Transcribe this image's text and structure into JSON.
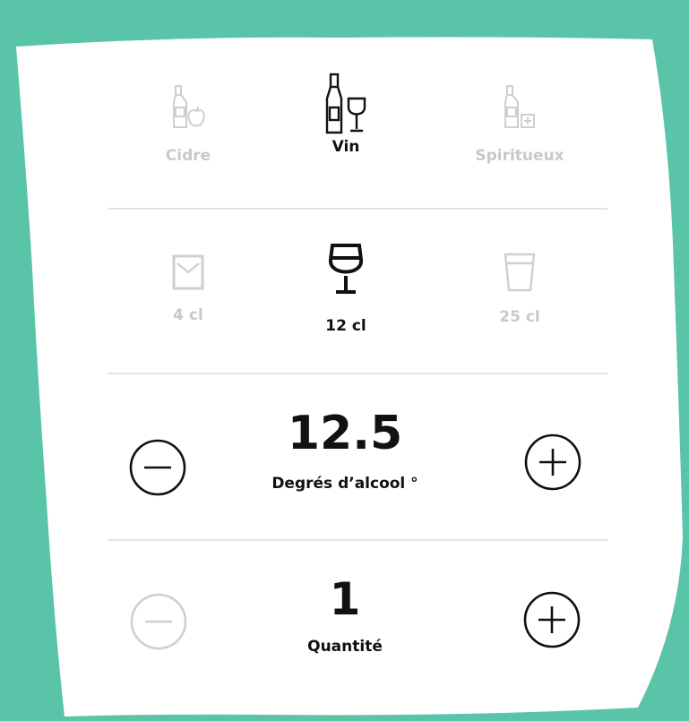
{
  "drink_types": [
    {
      "label": "Cidre",
      "icon": "cider-bottle-icon",
      "selected": false
    },
    {
      "label": "Vin",
      "icon": "wine-bottle-glass-icon",
      "selected": true
    },
    {
      "label": "Spiritueux",
      "icon": "spirits-bottle-icon",
      "selected": false
    }
  ],
  "volumes": [
    {
      "label": "4 cl",
      "icon": "shot-glass-icon",
      "selected": false
    },
    {
      "label": "12 cl",
      "icon": "wine-glass-icon",
      "selected": true
    },
    {
      "label": "25 cl",
      "icon": "tumbler-glass-icon",
      "selected": false
    }
  ],
  "alcohol": {
    "value": "12.5",
    "label": "Degrés d’alcool °"
  },
  "quantity": {
    "value": "1",
    "label": "Quantité"
  },
  "colors": {
    "background": "#5ac4a8",
    "card": "#ffffff",
    "text": "#111111",
    "muted": "#c8c8c8",
    "divider": "#e4e4e4"
  }
}
